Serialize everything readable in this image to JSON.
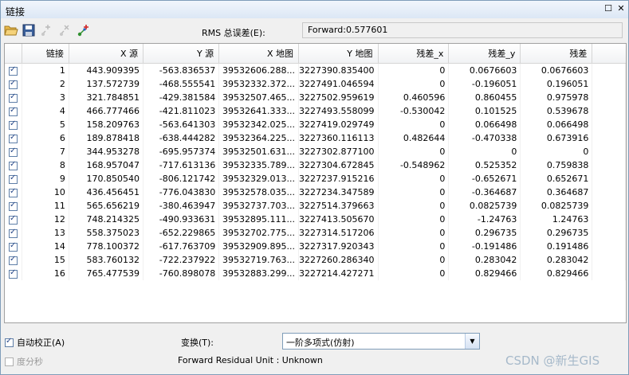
{
  "window": {
    "title": "链接"
  },
  "toolbar": {
    "rms_label": "RMS 总误差(E):",
    "rms_value": "Forward:0.577601",
    "icons": [
      "open-icon",
      "save-icon",
      "add-point-icon",
      "delete-point-icon",
      "add-link-icon"
    ]
  },
  "table": {
    "headers": [
      "链接",
      "X 源",
      "Y 源",
      "X 地图",
      "Y 地图",
      "残差_x",
      "残差_y",
      "残差"
    ],
    "rows": [
      {
        "checked": true,
        "cells": [
          "1",
          "443.909395",
          "-563.836537",
          "39532606.288...",
          "3227390.835400",
          "0",
          "0.0676603",
          "0.0676603"
        ]
      },
      {
        "checked": true,
        "cells": [
          "2",
          "137.572739",
          "-468.555541",
          "39532332.372...",
          "3227491.046594",
          "0",
          "-0.196051",
          "0.196051"
        ]
      },
      {
        "checked": true,
        "cells": [
          "3",
          "321.784851",
          "-429.381584",
          "39532507.465...",
          "3227502.959619",
          "0.460596",
          "0.860455",
          "0.975978"
        ]
      },
      {
        "checked": true,
        "cells": [
          "4",
          "466.777466",
          "-421.811023",
          "39532641.333...",
          "3227493.558099",
          "-0.530042",
          "0.101525",
          "0.539678"
        ]
      },
      {
        "checked": true,
        "cells": [
          "5",
          "158.209763",
          "-563.641303",
          "39532342.025...",
          "3227419.029749",
          "0",
          "0.066498",
          "0.066498"
        ]
      },
      {
        "checked": true,
        "cells": [
          "6",
          "189.878418",
          "-638.444282",
          "39532364.225...",
          "3227360.116113",
          "0.482644",
          "-0.470338",
          "0.673916"
        ]
      },
      {
        "checked": true,
        "cells": [
          "7",
          "344.953278",
          "-695.957374",
          "39532501.631...",
          "3227302.877100",
          "0",
          "0",
          "0"
        ]
      },
      {
        "checked": true,
        "cells": [
          "8",
          "168.957047",
          "-717.613136",
          "39532335.789...",
          "3227304.672845",
          "-0.548962",
          "0.525352",
          "0.759838"
        ]
      },
      {
        "checked": true,
        "cells": [
          "9",
          "170.850540",
          "-806.121742",
          "39532329.013...",
          "3227237.915216",
          "0",
          "-0.652671",
          "0.652671"
        ]
      },
      {
        "checked": true,
        "cells": [
          "10",
          "436.456451",
          "-776.043830",
          "39532578.035...",
          "3227234.347589",
          "0",
          "-0.364687",
          "0.364687"
        ]
      },
      {
        "checked": true,
        "cells": [
          "11",
          "565.656219",
          "-380.463947",
          "39532737.703...",
          "3227514.379663",
          "0",
          "0.0825739",
          "0.0825739"
        ]
      },
      {
        "checked": true,
        "cells": [
          "12",
          "748.214325",
          "-490.933631",
          "39532895.111...",
          "3227413.505670",
          "0",
          "-1.24763",
          "1.24763"
        ]
      },
      {
        "checked": true,
        "cells": [
          "13",
          "558.375023",
          "-652.229865",
          "39532702.775...",
          "3227314.517206",
          "0",
          "0.296735",
          "0.296735"
        ]
      },
      {
        "checked": true,
        "cells": [
          "14",
          "778.100372",
          "-617.763709",
          "39532909.895...",
          "3227317.920343",
          "0",
          "-0.191486",
          "0.191486"
        ]
      },
      {
        "checked": true,
        "cells": [
          "15",
          "583.760132",
          "-722.237922",
          "39532719.763...",
          "3227260.286340",
          "0",
          "0.283042",
          "0.283042"
        ]
      },
      {
        "checked": true,
        "cells": [
          "16",
          "765.477539",
          "-760.898078",
          "39532883.299...",
          "3227214.427271",
          "0",
          "0.829466",
          "0.829466"
        ]
      }
    ]
  },
  "bottom": {
    "auto_adjust_label": "自动校正(A)",
    "auto_adjust_checked": true,
    "dms_label": "度分秒",
    "dms_checked": false,
    "transform_label": "变换(T):",
    "transform_value": "一阶多项式(仿射)",
    "unit_text": "Forward Residual Unit : Unknown"
  },
  "watermark": "CSDN @新生GIS"
}
